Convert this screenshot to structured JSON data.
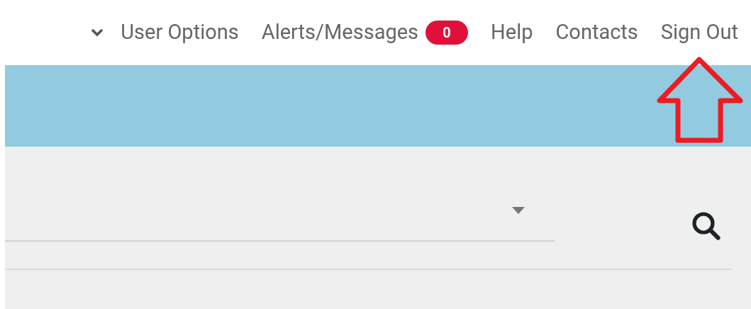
{
  "top_nav": {
    "items": [
      {
        "label": "User Options",
        "kind": "menu"
      },
      {
        "label": "Alerts/Messages",
        "kind": "link",
        "badge": "0"
      },
      {
        "label": "Help",
        "kind": "link"
      },
      {
        "label": "Contacts",
        "kind": "link"
      },
      {
        "label": "Sign Out",
        "kind": "link"
      }
    ]
  },
  "annotation": {
    "kind": "arrow",
    "color": "#ed1c24"
  }
}
